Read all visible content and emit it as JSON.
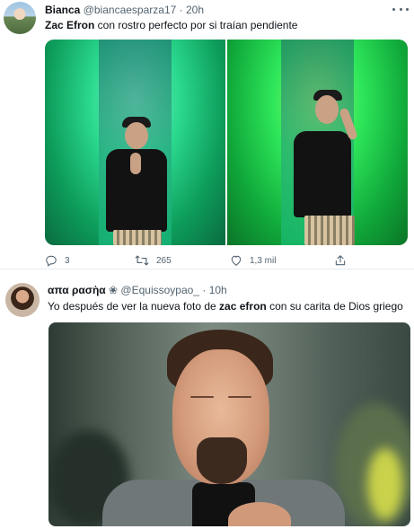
{
  "tweet1": {
    "author_name": "Bianca",
    "author_handle": "@biancaesparza17",
    "separator": "·",
    "time": "20h",
    "text_bold": "Zac Efron",
    "text_rest": " con rostro perfecto por si traían pendiente",
    "actions": {
      "reply_count": "3",
      "retweet_count": "265",
      "like_count": "1,3 mil"
    }
  },
  "tweet2": {
    "author_name": "απα ρασὴα",
    "author_emoji": "❀",
    "author_handle": "@Equissoypao_",
    "separator": "·",
    "time": "10h",
    "text_before": "Yo después de ver la nueva foto de ",
    "text_bold": "zac efron",
    "text_after": " con su carita de Dios griego"
  },
  "colors": {
    "text": "#0f1419",
    "muted": "#536471",
    "divider": "#e6ecf0",
    "green_left": "#2bd98e",
    "green_right": "#2ee65a"
  },
  "icons": [
    "more-icon",
    "reply-icon",
    "retweet-icon",
    "like-icon",
    "share-icon"
  ]
}
